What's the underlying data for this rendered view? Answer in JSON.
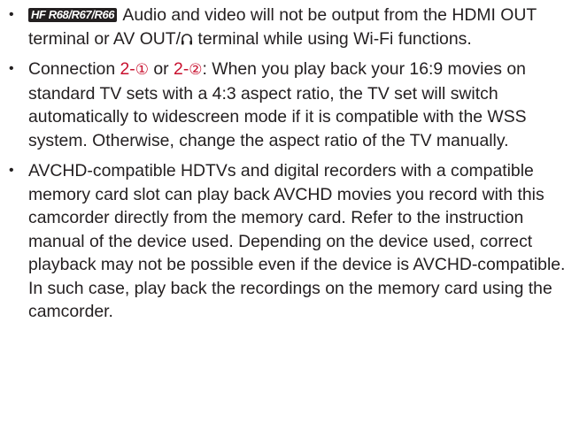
{
  "notes": [
    {
      "badge": "HF R68/R67/R66",
      "text_before_icon": " Audio and video will not be output from the HDMI OUT terminal or AV OUT/",
      "icon": "headphone-icon",
      "text_after_icon": " terminal while using Wi-Fi functions."
    },
    {
      "prefix": "Connection ",
      "ref1_num": "2-",
      "ref1_circle": "①",
      "or_text": " or ",
      "ref2_num": "2-",
      "ref2_circle": "②",
      "text": ": When you play back your 16:9 mov­ies on standard TV sets with a 4:3 aspect ratio, the TV set will switch automatically to widescreen mode if it is compatible with the WSS system. Otherwise, change the aspect ratio of the TV manually."
    },
    {
      "text": "AVCHD-compatible HDTVs and digital recorders with a com­patible memory card slot can play back AVCHD movies you record with this camcorder directly from the memory card. Refer to the instruction manual of the device used. Depending on the device used, correct playback may not be possible even if the device is AVCHD-compatible. In such case, play back the recordings on the memory card using the cam­corder."
    }
  ],
  "bullet_char": "•",
  "colors": {
    "text": "#231f20",
    "accent": "#c8102e"
  }
}
